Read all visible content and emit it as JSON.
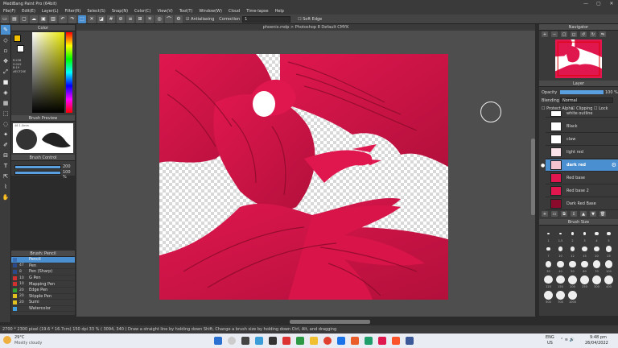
{
  "window": {
    "title": "MediBang Paint Pro (64bit)",
    "controls": [
      "—",
      "▢",
      "✕"
    ]
  },
  "menu": [
    "File(F)",
    "Edit(E)",
    "Layer(L)",
    "Filter(R)",
    "Select(S)",
    "Snap(N)",
    "Color(C)",
    "View(V)",
    "Tool(T)",
    "Window(W)",
    "Cloud",
    "Time-lapse",
    "Help"
  ],
  "toolbar": {
    "antialiasing": "Antialiasing",
    "correction_label": "Correction",
    "correction_value": "1",
    "soft_edge": "Soft Edge"
  },
  "document_tab": "phoenix.mdp > Photoshop 8 Default CMYK",
  "color_panel": {
    "title": "Color",
    "readout_lines": [
      "R:236",
      "G:242",
      "B:19",
      "#ECF20E"
    ],
    "accent": "#ecf20e"
  },
  "brush_preview": {
    "title": "Brush Preview",
    "size_label": "48 1.0mm"
  },
  "brush_control": {
    "title": "Brush Control",
    "size_value": "200",
    "opacity_value": "100 %"
  },
  "brush_panel": {
    "title": "Brush: Pencil",
    "items": [
      {
        "size": "",
        "name": "Pencil",
        "color": "#3a6fb5"
      },
      {
        "size": "47",
        "name": "Pen",
        "color": "#2a4a8a"
      },
      {
        "size": "8",
        "name": "Pen (Sharp)",
        "color": "#2a4a8a"
      },
      {
        "size": "10",
        "name": "G Pen",
        "color": "#d03030"
      },
      {
        "size": "10",
        "name": "Mapping Pen",
        "color": "#d03030"
      },
      {
        "size": "20",
        "name": "Edge Pen",
        "color": "#30a030"
      },
      {
        "size": "20",
        "name": "Stipple Pen",
        "color": "#e0c020"
      },
      {
        "size": "20",
        "name": "Sumi",
        "color": "#e0c020"
      },
      {
        "size": "",
        "name": "Watercolor",
        "color": "#40a0e0"
      }
    ]
  },
  "navigator": {
    "title": "Navigator"
  },
  "layer_panel": {
    "title": "Layer",
    "opacity_label": "Opacity",
    "opacity_value": "100 %",
    "blending_label": "Blending",
    "blending_value": "Normal",
    "protect_alpha": "Protect Alpha",
    "clipping": "Clipping",
    "lock": "Lock",
    "layers": [
      {
        "name": "white outline",
        "selected": false
      },
      {
        "name": "Black",
        "selected": false
      },
      {
        "name": "claw",
        "selected": false
      },
      {
        "name": "light red",
        "selected": false
      },
      {
        "name": "dark red",
        "selected": true
      },
      {
        "name": "Red base",
        "selected": false
      },
      {
        "name": "Red base 2",
        "selected": false
      },
      {
        "name": "Dark Red Base",
        "selected": false
      }
    ]
  },
  "brush_size": {
    "title": "Brush Size",
    "sizes": [
      "1",
      "1.5",
      "2",
      "3",
      "4",
      "5",
      "7",
      "10",
      "12",
      "15",
      "20",
      "25",
      "30",
      "40",
      "50",
      "60",
      "70",
      "100",
      "120",
      "150",
      "200",
      "250",
      "300",
      "400",
      "500",
      "700",
      "1000"
    ]
  },
  "status_bar": "2700 * 2300 pixel  (19.6 * 16.7cm)  150 dpi  33 %  ( 3094, 340 )  Draw a straight line by holding down Shift, Change a brush size by holding down Ctrl, Alt, and dragging",
  "taskbar": {
    "weather_temp": "29°C",
    "weather_desc": "Mostly cloudy",
    "lang": "ENG",
    "region": "US",
    "time": "9:48 pm",
    "date": "26/04/2022"
  },
  "artwork": {
    "main_color": "#e0174f",
    "shadow_color": "#8a0b2c"
  }
}
